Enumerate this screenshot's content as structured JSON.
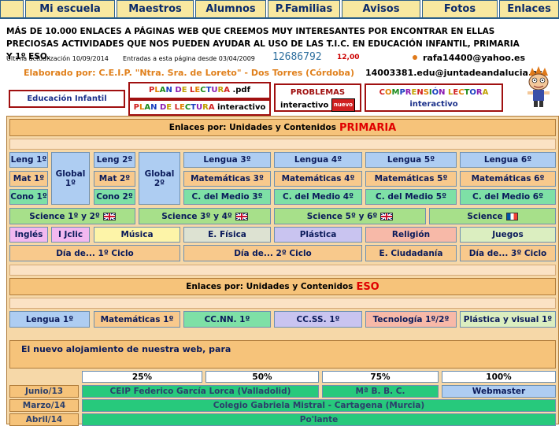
{
  "nav": [
    "Mi escuela",
    "Maestros",
    "Alumnos",
    "P.Familias",
    "Avisos",
    "Fotos",
    "Enlaces"
  ],
  "intro": "MÁS DE 10.000 ENLACES A PÁGINAS WEB QUE CREEMOS MUY INTERESANTES POR ENCONTRAR EN ELLAS PRECIOSAS ACTIVIDADES QUE NOS PUEDEN AYUDAR AL USO DE LAS T.I.C. EN EDUCACIÓN INFANTIL, PRIMARIA Y 1º ESO.",
  "updated": "Ultima actualización 10/09/2014",
  "entries": "Entradas a esta página desde 03/04/2009",
  "counter": "12686792",
  "counter_small": "12,00",
  "email1": "rafa14400@yahoo.es",
  "email2": "14003381.edu@juntadeandalucia.es",
  "author": "Elaborado por: C.E.I.P. \"Ntra. Sra. de Loreto\" - Dos Torres (Córdoba)",
  "boxes": {
    "infantil": "Educación Infantil",
    "plan_pdf_prefix": "PLAN DE LECTURA",
    "plan_pdf_suffix": ".pdf",
    "plan_int_prefix": "PLAN DE LECTURA",
    "plan_int_suffix": "interactivo",
    "problemas": "PROBLEMAS",
    "problemas_sub": "interactivo",
    "nuevo": "nuevo",
    "comprension": "COMPRENSIÓN LECTORA",
    "comprension_sub": "interactivo"
  },
  "primaria": {
    "header": "Enlaces por: Unidades y Contenidos",
    "header_red": "PRIMARIA",
    "leng1": "Leng 1º",
    "mat1": "Mat 1º",
    "cono1": "Cono 1º",
    "global1": "Global 1º",
    "leng2": "Leng 2º",
    "mat2": "Mat 2º",
    "cono2": "Cono 2º",
    "global2": "Global 2º",
    "lengua": [
      "Lengua 3º",
      "Lengua 4º",
      "Lengua 5º",
      "Lengua 6º"
    ],
    "mates": [
      "Matemáticas 3º",
      "Matemáticas 4º",
      "Matemáticas 5º",
      "Matemáticas 6º"
    ],
    "medio": [
      "C. del Medio 3º",
      "C. del Medio 4º",
      "C. del Medio 5º",
      "C. del Medio 6º"
    ],
    "science": [
      "Science 1º y 2º",
      "Science 3º y 4º",
      "Science 5º y 6º",
      "Science"
    ],
    "ingles": "Inglés",
    "jclic": "I Jclic",
    "musica": "Música",
    "fisica": "E. Física",
    "plastica": "Plástica",
    "religion": "Religión",
    "juegos": "Juegos",
    "dia1": "Día de... 1º Ciclo",
    "dia2": "Día de... 2º Ciclo",
    "ciudadania": "E. Ciudadanía",
    "dia3": "Día de... 3º Ciclo"
  },
  "eso": {
    "header": "Enlaces por: Unidades y Contenidos",
    "header_red": "ESO",
    "items": [
      "Lengua 1º",
      "Matemáticas 1º",
      "CC.NN. 1º",
      "CC.SS. 1º",
      "Tecnología 1º/2º",
      "Plástica y visual 1º"
    ]
  },
  "alojamiento": "El nuevo alojamiento de nuestra web, para",
  "progress": {
    "labels": [
      "25%",
      "50%",
      "75%",
      "100%"
    ],
    "rows": [
      {
        "date": "Junio/13",
        "a": "CEIP Federico García Lorca (Valladolid)",
        "b": "Mª B. B. C.",
        "c": "Webmaster"
      },
      {
        "date": "Marzo/14",
        "a": "Colegio Gabriela Mistral - Cartagena (Murcia)"
      },
      {
        "date": "Abril/14",
        "a": "Po'lante"
      }
    ]
  }
}
